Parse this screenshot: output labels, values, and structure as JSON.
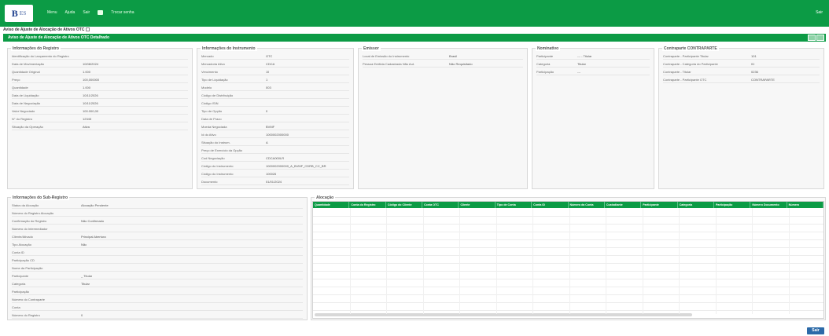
{
  "app": {
    "logo": "B",
    "logo_sub": "ES"
  },
  "topnav": [
    "Menu",
    "Ajuda",
    "Sair",
    "Trocar senha"
  ],
  "user": "Sair",
  "breadcrumb": "Aviso de Ajuste de Alocação de Ativos OTC",
  "window_title": "Aviso de Ajuste de Alocação de Ativos OTC Detalhado",
  "colors": {
    "brand": "#0c9b45",
    "button": "#2c6aa8"
  },
  "panels": {
    "registro": {
      "title": "Informações do Registro",
      "rows": [
        {
          "label": "Identificação do Lançamento do Registro",
          "value": ""
        },
        {
          "label": "Data de Movimentação",
          "value": "10/08/2024"
        },
        {
          "label": "Quantidade Original",
          "value": "1.000"
        },
        {
          "label": "Preço",
          "value": "100,000000"
        },
        {
          "label": "Quantidade",
          "value": "1.000"
        },
        {
          "label": "Data de Liquidação",
          "value": "10/11/2026"
        },
        {
          "label": "Data de Negociação",
          "value": "10/11/2026"
        },
        {
          "label": "Valor Negociado",
          "value": "100.000,00"
        },
        {
          "label": "N° do Registro",
          "value": "12345"
        },
        {
          "label": "Situação da Operação",
          "value": "Ativa"
        }
      ]
    },
    "ativo": {
      "title": "Informações do Instrumento",
      "rows": [
        {
          "label": "Mercado",
          "value": "OTC"
        },
        {
          "label": "Mercadoria Ativo",
          "value": "CDCA"
        },
        {
          "label": "Vencimento",
          "value": "15"
        },
        {
          "label": "Tipo de Liquidação",
          "value": "1"
        },
        {
          "label": "Modelo",
          "value": "003"
        },
        {
          "label": "Código de Distribuição",
          "value": ""
        },
        {
          "label": "Código ISIN",
          "value": ""
        },
        {
          "label": "Tipo de Opção",
          "value": "0"
        },
        {
          "label": "Data de Prazo",
          "value": ""
        },
        {
          "label": "Moeda Negociada",
          "value": "BVMF"
        },
        {
          "label": "Id do Ativo",
          "value": "1000002000000"
        },
        {
          "label": "Situação do Instrum.",
          "value": "A"
        },
        {
          "label": "Preço de Exercício da Opção",
          "value": ""
        },
        {
          "label": "Cod Negociação",
          "value": "CDCA000LR"
        },
        {
          "label": "Código do Instrumento",
          "value": "1000002000000_A_BVMF_CDRB_CC_BR"
        },
        {
          "label": "Código do Instrumento",
          "value": "100026"
        },
        {
          "label": "Documento",
          "value": "01/01/2024"
        }
      ]
    },
    "emissor": {
      "title": "Emissor",
      "rows": [
        {
          "label": "Local de Emissão do Instrumento",
          "value": "Brasil"
        },
        {
          "label": "Pessoa Emitida Cadastrada Não Aut.",
          "value": "Não Requisitado"
        }
      ]
    },
    "nominativo": {
      "title": "Nominativo",
      "rows": [
        {
          "label": "Participante",
          "value": "--- - Titular"
        },
        {
          "label": "Categoria",
          "value": "Titular"
        },
        {
          "label": "Participação",
          "value": "---"
        }
      ]
    },
    "contraparte": {
      "title": "Contraparte CONTRAPARTE",
      "rows": [
        {
          "label": "Contraparte - Participante Titular",
          "value": "101"
        },
        {
          "label": "Contraparte - Categoria do Participante",
          "value": "01"
        },
        {
          "label": "Contraparte - Titular",
          "value": "0236"
        },
        {
          "label": "Contraparte - Participante OTC",
          "value": "CONTRAPARTE"
        }
      ]
    },
    "sub": {
      "title": "Informações do Sub-Registro",
      "rows": [
        {
          "label": "Status da Alocação",
          "value": "Alocação Pendente"
        },
        {
          "label": "Número do Registro Alocação",
          "value": ""
        },
        {
          "label": "Confirmação do Registro",
          "value": "Não Confirmado"
        },
        {
          "label": "Número do Intermediador",
          "value": ""
        },
        {
          "label": "Cliente/Ativado",
          "value": "Principal  Abertura"
        },
        {
          "label": "Tipo Alocação",
          "value": "Não"
        },
        {
          "label": "Conta ID",
          "value": ""
        },
        {
          "label": "Participação CD",
          "value": ""
        },
        {
          "label": "Nome da Participação",
          "value": ""
        },
        {
          "label": "Participante",
          "value": "_ Titular"
        },
        {
          "label": "Categoria",
          "value": "Titular"
        },
        {
          "label": "Participação",
          "value": ""
        },
        {
          "label": "Número do Contraparte",
          "value": ""
        },
        {
          "label": "Conta",
          "value": ""
        },
        {
          "label": "Número do Registro",
          "value": "0"
        }
      ]
    }
  },
  "alocacao": {
    "title": "Alocação",
    "columns": [
      "Quantidade",
      "Conta do Registro",
      "Código do Cliente",
      "Conta OTC",
      "Cliente",
      "Tipo de Conta",
      "Conta ID",
      "Número da Conta",
      "Custodiante",
      "Participante",
      "Categoria",
      "Participação",
      "Número Documento",
      "Número"
    ]
  },
  "button_exit": "Sair"
}
